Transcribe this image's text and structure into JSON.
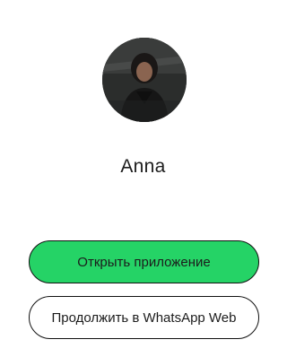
{
  "contact": {
    "name": "Anna",
    "avatar_icon": "profile-photo"
  },
  "actions": {
    "open_app_label": "Открыть приложение",
    "continue_web_label": "Продолжить в WhatsApp Web"
  },
  "colors": {
    "primary_button": "#25d366",
    "secondary_button": "#ffffff",
    "border": "#111111",
    "text": "#1c1c1c"
  }
}
